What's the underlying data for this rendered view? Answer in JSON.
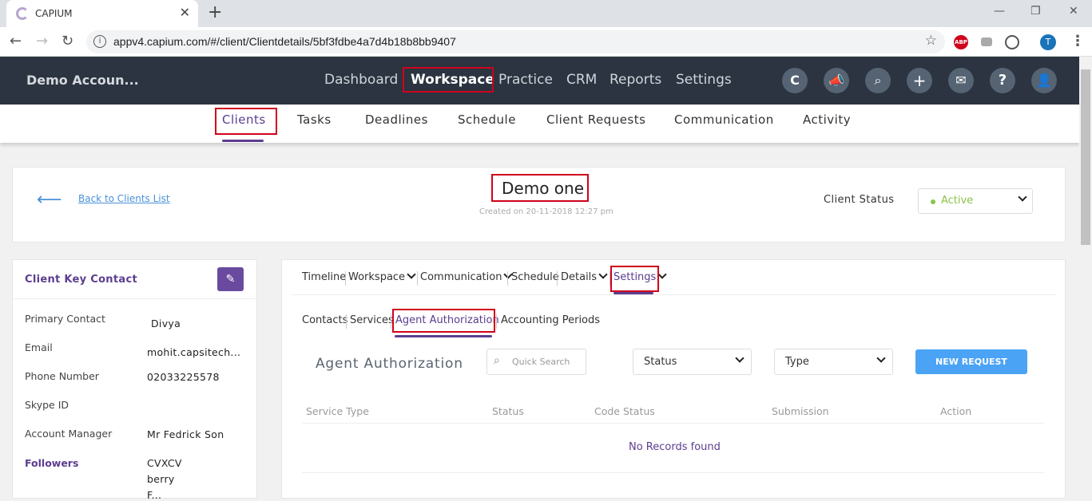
{
  "browser": {
    "tab_title": "CAPIUM",
    "url": "appv4.capium.com/#/client/Clientdetails/5bf3fdbe4a7d4b18b8bb9407",
    "profile_initial": "T"
  },
  "header": {
    "account": "Demo Accoun...",
    "nav": [
      "Dashboard",
      "Workspace",
      "Practice",
      "CRM",
      "Reports",
      "Settings"
    ],
    "active_nav": "Workspace"
  },
  "subnav": {
    "items": [
      "Clients",
      "Tasks",
      "Deadlines",
      "Schedule",
      "Client Requests",
      "Communication",
      "Activity"
    ],
    "active": "Clients"
  },
  "client": {
    "back_label": "Back to Clients List",
    "name": "Demo one",
    "created": "Created on 20-11-2018 12:27 pm",
    "status_label": "Client Status",
    "status_value": "Active"
  },
  "key_contact": {
    "title": "Client Key Contact",
    "rows": [
      {
        "label": "Primary Contact",
        "value": "Divya"
      },
      {
        "label": "Email",
        "value": "mohit.capsitech..."
      },
      {
        "label": "Phone Number",
        "value": "02033225578"
      },
      {
        "label": "Skype ID",
        "value": ""
      },
      {
        "label": "Account Manager",
        "value": "Mr Fedrick Son"
      }
    ],
    "followers_label": "Followers",
    "followers": [
      "CVXCV",
      "berry",
      "F..."
    ]
  },
  "detail_tabs": {
    "items": [
      "Timeline",
      "Workspace",
      "Communication",
      "Schedule",
      "Details",
      "Settings"
    ],
    "active": "Settings"
  },
  "settings_tabs": {
    "items": [
      "Contacts",
      "Services",
      "Agent Authorization",
      "Accounting Periods"
    ],
    "active": "Agent Authorization"
  },
  "agent_auth": {
    "title": "Agent Authorization",
    "search_placeholder": "Quick Search",
    "status_select": "Status",
    "type_select": "Type",
    "new_request": "NEW REQUEST",
    "columns": [
      "Service Type",
      "Status",
      "Code Status",
      "Submission",
      "Action"
    ],
    "empty": "No Records found"
  },
  "colors": {
    "accent": "#5b3d8f",
    "topbar": "#2b3440",
    "button": "#4aa3f5",
    "highlight": "#d0021b",
    "active_status": "#8bc34a"
  }
}
